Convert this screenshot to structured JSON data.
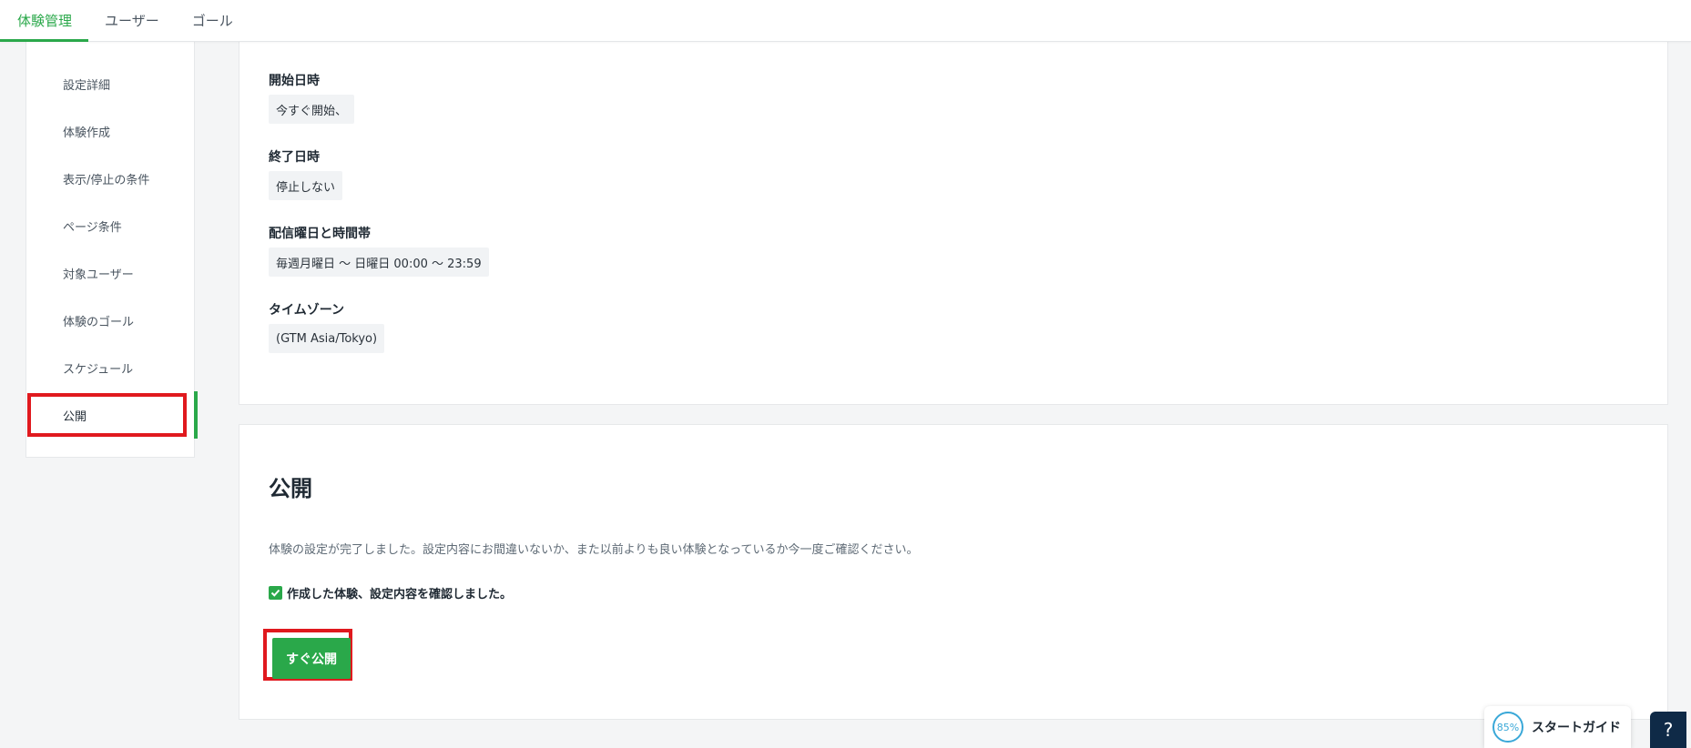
{
  "topnav": {
    "tabs": [
      {
        "label": "体験管理",
        "active": true
      },
      {
        "label": "ユーザー",
        "active": false
      },
      {
        "label": "ゴール",
        "active": false
      }
    ]
  },
  "sidebar": {
    "items": [
      {
        "label": "設定詳細"
      },
      {
        "label": "体験作成"
      },
      {
        "label": "表示/停止の条件"
      },
      {
        "label": "ページ条件"
      },
      {
        "label": "対象ユーザー"
      },
      {
        "label": "体験のゴール"
      },
      {
        "label": "スケジュール"
      },
      {
        "label": "公開",
        "active": true
      }
    ]
  },
  "schedule": {
    "start": {
      "label": "開始日時",
      "value": "今すぐ開始、"
    },
    "end": {
      "label": "終了日時",
      "value": "停止しない"
    },
    "delivery": {
      "label": "配信曜日と時間帯",
      "value": "毎週月曜日 〜 日曜日 00:00 〜 23:59"
    },
    "timezone": {
      "label": "タイムゾーン",
      "value": "(GTM Asia/Tokyo)"
    }
  },
  "publish": {
    "title": "公開",
    "description": "体験の設定が完了しました。設定内容にお間違いないか、また以前よりも良い体験となっているか今一度ご確認ください。",
    "confirm_label": "作成した体験、設定内容を確認しました。",
    "confirm_checked": true,
    "button_label": "すぐ公開"
  },
  "guide": {
    "progress": "85%",
    "label": "スタートガイド",
    "help_symbol": "?"
  },
  "colors": {
    "accent": "#2aa84a",
    "highlight": "#e0191e",
    "help_bg": "#0f2a47",
    "guide_ring": "#3aa8d8"
  }
}
